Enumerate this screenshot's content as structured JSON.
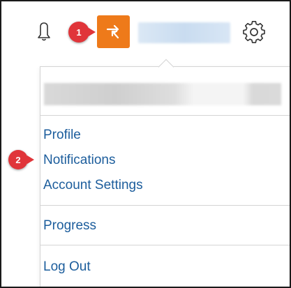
{
  "header": {
    "icons": {
      "notifications": "bell-icon",
      "switch_role": "arrows-exchange-icon",
      "settings": "gear-icon"
    },
    "switch_color": "#ee7a1a"
  },
  "callouts": {
    "first": "1",
    "second": "2",
    "color": "#e0353a"
  },
  "menu": {
    "items": [
      {
        "label": "Profile"
      },
      {
        "label": "Notifications"
      },
      {
        "label": "Account Settings"
      },
      {
        "label": "Progress"
      },
      {
        "label": "Log Out"
      }
    ],
    "link_color": "#1c5d9c"
  }
}
